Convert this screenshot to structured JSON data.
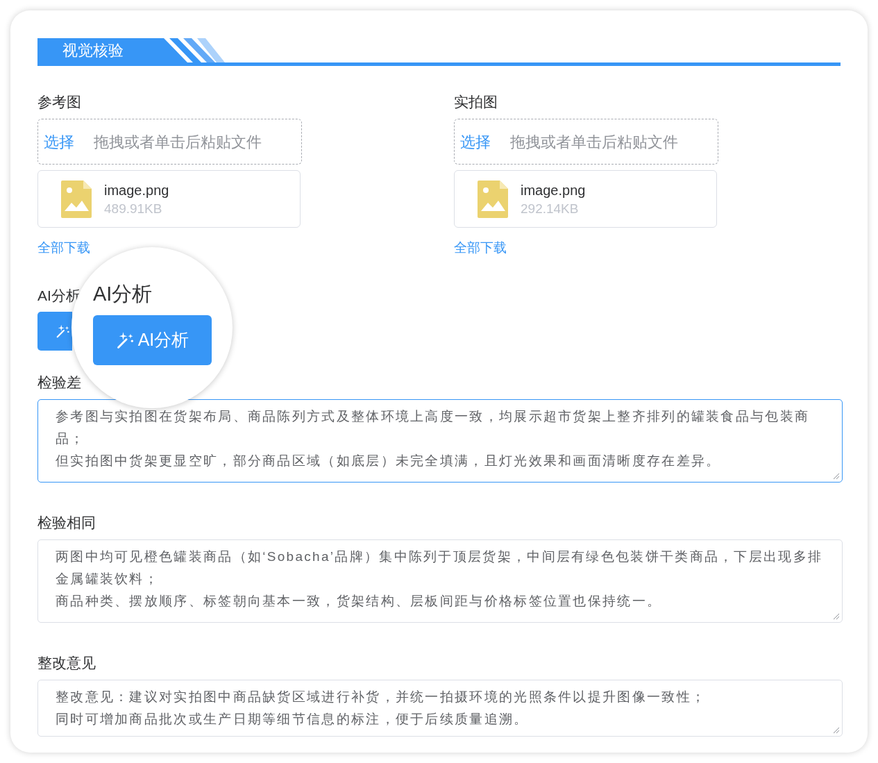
{
  "header": {
    "title": "视觉核验"
  },
  "uploads": [
    {
      "label": "参考图",
      "select": "选择",
      "hint": "拖拽或者单击后粘贴文件",
      "file": {
        "name": "image.png",
        "size": "489.91KB"
      },
      "download": "全部下载"
    },
    {
      "label": "实拍图",
      "select": "选择",
      "hint": "拖拽或者单击后粘贴文件",
      "file": {
        "name": "image.png",
        "size": "292.14KB"
      },
      "download": "全部下载"
    }
  ],
  "ai_section": {
    "label": "AI分析"
  },
  "magnifier": {
    "label": "AI分析",
    "button_label": "AI分析"
  },
  "fields": [
    {
      "label": "检验差",
      "focused": true,
      "paragraphs": [
        "参考图与实拍图在货架布局、商品陈列方式及整体环境上高度一致，均展示超市货架上整齐排列的罐装食品与包装商品；",
        "但实拍图中货架更显空旷，部分商品区域（如底层）未完全填满，且灯光效果和画面清晰度存在差异。"
      ]
    },
    {
      "label": "检验相同",
      "focused": false,
      "paragraphs": [
        "两图中均可见橙色罐装商品（如‘Sobacha’品牌）集中陈列于顶层货架，中间层有绿色包装饼干类商品，下层出现多排金属罐装饮料；",
        "商品种类、摆放顺序、标签朝向基本一致，货架结构、层板间距与价格标签位置也保持统一。"
      ]
    },
    {
      "label": "整改意见",
      "focused": false,
      "paragraphs": [
        "整改意见：建议对实拍图中商品缺货区域进行补货，并统一拍摄环境的光照条件以提升图像一致性；",
        "同时可增加商品批次或生产日期等细节信息的标注，便于后续质量追溯。"
      ]
    }
  ]
}
